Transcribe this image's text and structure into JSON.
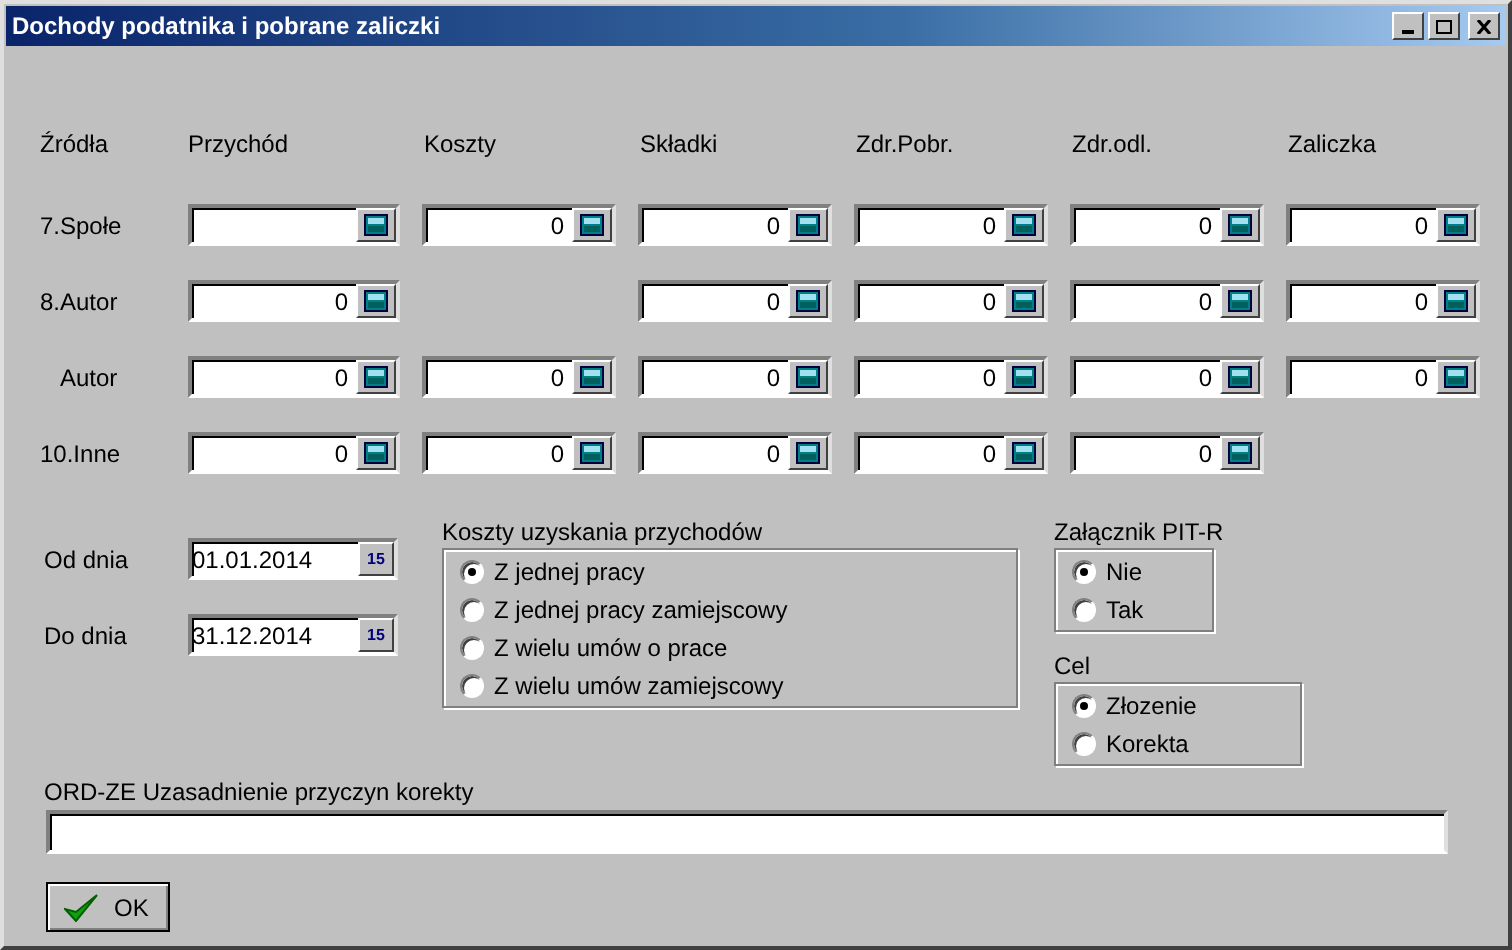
{
  "window": {
    "title": "Dochody podatnika i pobrane zaliczki"
  },
  "table": {
    "columns": [
      "Źródła",
      "Przychód",
      "Koszty",
      "Składki",
      "Zdr.Pobr.",
      "Zdr.odl.",
      "Zaliczka"
    ],
    "rows": [
      {
        "label": "7.Społe",
        "cells": [
          {
            "kind": "field"
          },
          {
            "kind": "field",
            "value": "0"
          },
          {
            "kind": "field",
            "value": "0"
          },
          {
            "kind": "field",
            "value": "0"
          },
          {
            "kind": "field",
            "value": "0"
          },
          {
            "kind": "field",
            "value": "0"
          }
        ]
      },
      {
        "label": "8.Autor",
        "cells": [
          {
            "kind": "field",
            "value": "0"
          },
          {
            "kind": "none"
          },
          {
            "kind": "field",
            "value": "0"
          },
          {
            "kind": "field",
            "value": "0"
          },
          {
            "kind": "field",
            "value": "0"
          },
          {
            "kind": "field",
            "value": "0"
          }
        ]
      },
      {
        "label": "Autor",
        "cells": [
          {
            "kind": "field",
            "value": "0"
          },
          {
            "kind": "field",
            "value": "0"
          },
          {
            "kind": "field",
            "value": "0"
          },
          {
            "kind": "field",
            "value": "0"
          },
          {
            "kind": "field",
            "value": "0"
          },
          {
            "kind": "field",
            "value": "0"
          }
        ]
      },
      {
        "label": "10.Inne",
        "cells": [
          {
            "kind": "field",
            "value": "0"
          },
          {
            "kind": "field",
            "value": "0"
          },
          {
            "kind": "field",
            "value": "0"
          },
          {
            "kind": "field",
            "value": "0"
          },
          {
            "kind": "field",
            "value": "0"
          },
          {
            "kind": "none"
          }
        ]
      }
    ]
  },
  "dates": [
    {
      "label": "Od dnia",
      "value": "01.01.2014",
      "button": "15"
    },
    {
      "label": "Do dnia",
      "value": "31.12.2014",
      "button": "15"
    }
  ],
  "koszty_group": {
    "title": "Koszty uzyskania przychodów",
    "options": [
      {
        "label": "Z jednej pracy",
        "selected": true
      },
      {
        "label": "Z jednej pracy zamiejscowy",
        "selected": false
      },
      {
        "label": "Z wielu umów o prace",
        "selected": false
      },
      {
        "label": "Z wielu umów zamiejscowy",
        "selected": false
      }
    ]
  },
  "pitr_group": {
    "title": "Załącznik PIT-R",
    "options": [
      {
        "label": "Nie",
        "selected": true
      },
      {
        "label": "Tak",
        "selected": false
      }
    ]
  },
  "cel_group": {
    "title": "Cel",
    "options": [
      {
        "label": "Złozenie",
        "selected": true
      },
      {
        "label": "Korekta",
        "selected": false
      }
    ]
  },
  "justification": {
    "label": "ORD-ZE Uzasadnienie przyczyn korekty"
  },
  "buttons": [
    {
      "label": "OK"
    }
  ]
}
